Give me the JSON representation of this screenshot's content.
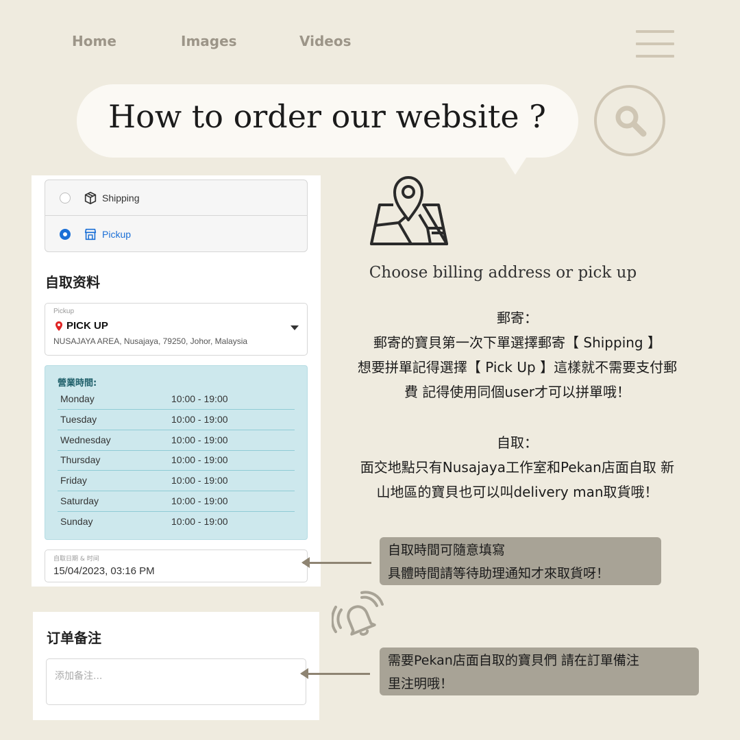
{
  "nav": {
    "home": "Home",
    "images": "Images",
    "videos": "Videos"
  },
  "icons": {
    "menu": "menu-icon",
    "search": "search-icon",
    "map": "map-pin-icon",
    "bell": "bell-icon"
  },
  "title": "How to order our website ?",
  "checkout": {
    "shipping_label": "Shipping",
    "pickup_label": "Pickup",
    "selected_option": "Pickup",
    "pickup_section_title": "自取资料",
    "pickup_select": {
      "label": "Pickup",
      "name": "PICK UP",
      "address": "NUSAJAYA AREA, Nusajaya, 79250, Johor, Malaysia"
    },
    "hours": {
      "title": "營業時間:",
      "rows": [
        {
          "day": "Monday",
          "time": "10:00 - 19:00"
        },
        {
          "day": "Tuesday",
          "time": "10:00 - 19:00"
        },
        {
          "day": "Wednesday",
          "time": "10:00 - 19:00"
        },
        {
          "day": "Thursday",
          "time": "10:00 - 19:00"
        },
        {
          "day": "Friday",
          "time": "10:00 - 19:00"
        },
        {
          "day": "Saturday",
          "time": "10:00 - 19:00"
        },
        {
          "day": "Sunday",
          "time": "10:00 - 19:00"
        }
      ]
    },
    "datetime": {
      "label": "自取日期 & 时间",
      "value": "15/04/2023, 03:16 PM"
    },
    "notes": {
      "title": "订单备注",
      "placeholder": "添加备注..."
    }
  },
  "guide": {
    "caption": "Choose billing address or pick up",
    "shipping_heading": "郵寄：",
    "shipping_lines": [
      "郵寄的寶貝第一次下單選擇郵寄【 Shipping 】",
      "想要拼單記得選擇【 Pick Up 】這樣就不需要支付郵",
      "費 記得使用同個user才可以拼單哦！"
    ],
    "pickup_heading": "自取：",
    "pickup_lines": [
      "面交地點只有Nusajaya工作室和Pekan店面自取 新",
      "山地區的寶貝也可以叫delivery man取貨哦！"
    ],
    "time_note": [
      "自取時間可隨意填寫",
      "具體時間請等待助理通知才來取貨呀！"
    ],
    "pekan_note": [
      "需要Pekan店面自取的寶貝們 請在訂單備注",
      "里注明哦！"
    ]
  },
  "colors": {
    "background": "#efebdf",
    "accent_blue": "#1b6fd6",
    "hours_bg": "#cde8ed",
    "note_bg": "#a8a396",
    "icon_beige": "#cfc6b4"
  }
}
